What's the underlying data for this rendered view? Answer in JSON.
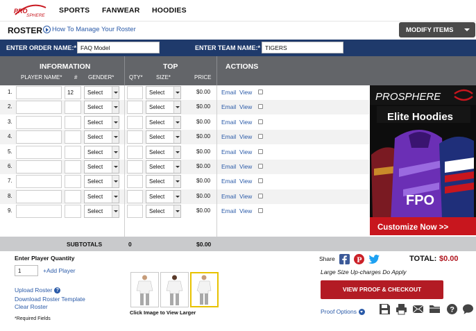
{
  "nav": {
    "logo_text": "PROSPHERE",
    "items": [
      "SPORTS",
      "FANWEAR",
      "HOODIES"
    ]
  },
  "roster": {
    "title": "ROSTER",
    "howto_link": "How To Manage Your Roster",
    "modify_label": "MODIFY ITEMS"
  },
  "order": {
    "order_label": "ENTER ORDER NAME:*",
    "order_value": "FAQ Model",
    "team_label": "ENTER TEAM NAME:*",
    "team_value": "TIGERS"
  },
  "table": {
    "groups": {
      "information": "INFORMATION",
      "top": "TOP",
      "actions": "ACTIONS"
    },
    "columns": {
      "player_name": "PLAYER NAME*",
      "number": "#",
      "gender": "GENDER*",
      "qty": "QTY*",
      "size": "SIZE*",
      "price": "PRICE"
    },
    "rows": [
      {
        "idx": "1.",
        "name": "",
        "number": "12",
        "gender": "Select",
        "qty": "",
        "size": "Select",
        "price": "$0.00",
        "email": "Email",
        "view": "View"
      },
      {
        "idx": "2.",
        "name": "",
        "number": "",
        "gender": "Select",
        "qty": "",
        "size": "Select",
        "price": "$0.00",
        "email": "Email",
        "view": "View"
      },
      {
        "idx": "3.",
        "name": "",
        "number": "",
        "gender": "Select",
        "qty": "",
        "size": "Select",
        "price": "$0.00",
        "email": "Email",
        "view": "View"
      },
      {
        "idx": "4.",
        "name": "",
        "number": "",
        "gender": "Select",
        "qty": "",
        "size": "Select",
        "price": "$0.00",
        "email": "Email",
        "view": "View"
      },
      {
        "idx": "5.",
        "name": "",
        "number": "",
        "gender": "Select",
        "qty": "",
        "size": "Select",
        "price": "$0.00",
        "email": "Email",
        "view": "View"
      },
      {
        "idx": "6.",
        "name": "",
        "number": "",
        "gender": "Select",
        "qty": "",
        "size": "Select",
        "price": "$0.00",
        "email": "Email",
        "view": "View"
      },
      {
        "idx": "7.",
        "name": "",
        "number": "",
        "gender": "Select",
        "qty": "",
        "size": "Select",
        "price": "$0.00",
        "email": "Email",
        "view": "View"
      },
      {
        "idx": "8.",
        "name": "",
        "number": "",
        "gender": "Select",
        "qty": "",
        "size": "Select",
        "price": "$0.00",
        "email": "Email",
        "view": "View"
      },
      {
        "idx": "9.",
        "name": "",
        "number": "",
        "gender": "Select",
        "qty": "",
        "size": "Select",
        "price": "$0.00",
        "email": "Email",
        "view": "View"
      }
    ],
    "subtotals_label": "SUBTOTALS",
    "subtotal_qty": "0",
    "subtotal_price": "$0.00"
  },
  "ad": {
    "brand": "PROSPHERE",
    "headline": "Elite Hoodies",
    "stamp": "FPO",
    "cta": "Customize Now >>"
  },
  "bottom": {
    "player_qty_label": "Enter Player Quantity",
    "player_qty_value": "1",
    "add_player": "+Add Player",
    "upload_roster": "Upload Roster",
    "help_glyph": "?",
    "download_template": "Download Roster Template",
    "clear_roster": "Clear Roster",
    "required_note": "*Required Fields",
    "thumb_caption": "Click Image to View Larger",
    "share_label": "Share",
    "total_label": "TOTAL:",
    "total_value": "$0.00",
    "upcharge_note": "Large Size Up-charges Do Apply",
    "cta": "VIEW PROOF & CHECKOUT",
    "proof_options": "Proof Options"
  },
  "colors": {
    "navy": "#1f3a6b",
    "header_gray": "#636569",
    "cta_red": "#b31b24",
    "link_blue": "#2a5aa8",
    "facebook": "#3b5998",
    "pinterest": "#cb2027",
    "twitter": "#1da1f2"
  },
  "icons": [
    "play-circle-icon",
    "chevron-down-icon",
    "facebook-icon",
    "pinterest-icon",
    "twitter-icon",
    "save-icon",
    "print-icon",
    "email-icon",
    "folder-icon",
    "help-icon",
    "chat-icon",
    "info-icon"
  ]
}
